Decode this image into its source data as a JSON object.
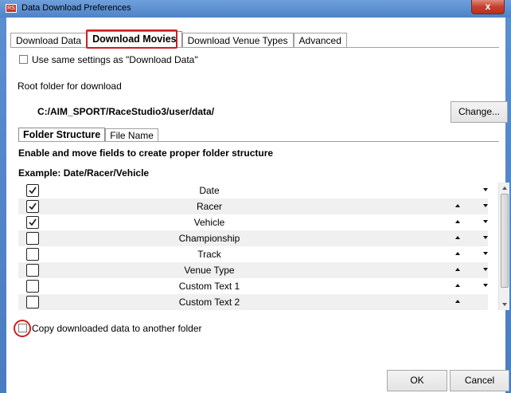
{
  "window": {
    "title": "Data Download Preferences",
    "close_label": "x",
    "app_icon_label": "RS"
  },
  "main_tabs": [
    {
      "label": "Download Data",
      "active": false
    },
    {
      "label": "Download Movies",
      "active": true
    },
    {
      "label": "Download Venue Types",
      "active": false
    },
    {
      "label": "Advanced",
      "active": false
    }
  ],
  "use_same": {
    "label": "Use same settings as \"Download Data\"",
    "checked": false
  },
  "root_folder": {
    "label": "Root folder for download",
    "path": "C:/AIM_SPORT/RaceStudio3/user/data/",
    "change_label": "Change..."
  },
  "sub_tabs": [
    {
      "label": "Folder Structure",
      "active": true
    },
    {
      "label": "File Name",
      "active": false
    }
  ],
  "instructions": "Enable and move fields to create proper folder structure",
  "example": "Example: Date/Racer/Vehicle",
  "fields": [
    {
      "label": "Date",
      "checked": true,
      "up": false,
      "down": true
    },
    {
      "label": "Racer",
      "checked": true,
      "up": true,
      "down": true
    },
    {
      "label": "Vehicle",
      "checked": true,
      "up": true,
      "down": true
    },
    {
      "label": "Championship",
      "checked": false,
      "up": true,
      "down": true
    },
    {
      "label": "Track",
      "checked": false,
      "up": true,
      "down": true
    },
    {
      "label": "Venue Type",
      "checked": false,
      "up": true,
      "down": true
    },
    {
      "label": "Custom Text 1",
      "checked": false,
      "up": true,
      "down": true
    },
    {
      "label": "Custom Text 2",
      "checked": false,
      "up": true,
      "down": false
    }
  ],
  "copy_option": {
    "label": "Copy downloaded data to another folder",
    "checked": false
  },
  "buttons": {
    "ok": "OK",
    "cancel": "Cancel"
  },
  "colors": {
    "title_bar": "#5b8fd0",
    "highlight": "#cc1f1f",
    "close": "#c4402d"
  }
}
